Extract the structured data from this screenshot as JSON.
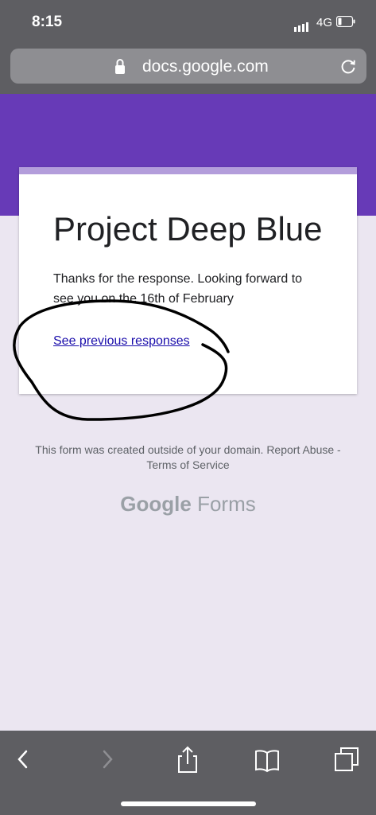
{
  "status_bar": {
    "time": "8:15",
    "network": "4G"
  },
  "browser": {
    "url": "docs.google.com"
  },
  "form": {
    "title": "Project Deep Blue",
    "confirmation": "Thanks for the response. Looking forward to see  you on the 16th of February",
    "previous_link": "See previous responses"
  },
  "footer": {
    "notice": "This form was created outside of your domain. Report Abuse - Terms of Service",
    "brand_google": "Google",
    "brand_forms": "Forms"
  },
  "colors": {
    "header_purple": "#673ab7",
    "card_accent": "#b39ddb",
    "background": "#ebe6f1",
    "link": "#1a0dab"
  },
  "toolbar": {
    "icons": [
      "back-icon",
      "forward-icon",
      "share-icon",
      "bookmarks-icon",
      "tabs-icon"
    ]
  }
}
